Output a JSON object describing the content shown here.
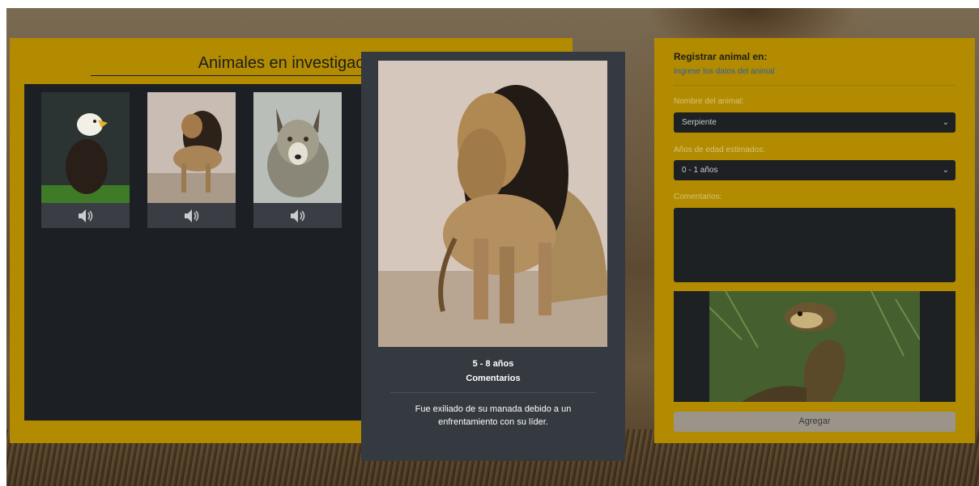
{
  "left": {
    "title": "Animales en investigac",
    "cards": [
      {
        "name": "eagle",
        "sound_icon": "speaker-icon"
      },
      {
        "name": "lion",
        "sound_icon": "speaker-icon"
      },
      {
        "name": "wolf",
        "sound_icon": "speaker-icon"
      }
    ]
  },
  "modal": {
    "age": "5 - 8 años",
    "comments_label": "Comentarios",
    "comment": "Fue exiliado de su manada debido a un enfrentamiento con su líder."
  },
  "form": {
    "title": "Registrar animal en:",
    "subtitle": "Ingrese los datos del animal",
    "animal_label": "Nombre del animal:",
    "animal_value": "Serpiente",
    "age_label": "Años de edad estimados:",
    "age_value": "0 - 1 años",
    "comments_label": "Comentarios:",
    "comments_value": "",
    "submit_label": "Agregar"
  },
  "colors": {
    "panel": "#b28b00",
    "dark": "#1c1f23",
    "modal": "#343a40",
    "link": "#2b5ea8"
  }
}
